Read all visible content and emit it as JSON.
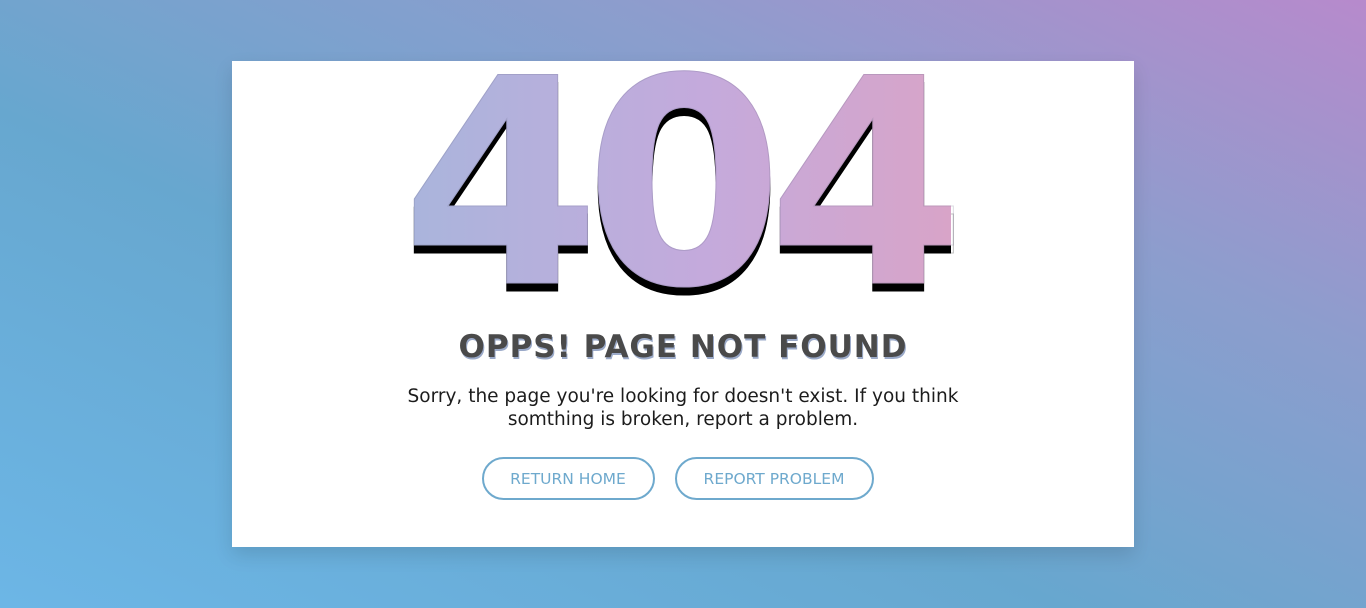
{
  "error": {
    "code": "404",
    "title": "OPPS! PAGE NOT FOUND",
    "message": "Sorry, the page you're looking for doesn't exist. If you think somthing is broken, report a problem."
  },
  "actions": {
    "home_label": "RETURN HOME",
    "report_label": "REPORT PROBLEM"
  },
  "colors": {
    "background_start": "#6cb6e6",
    "background_end": "#b78acc",
    "accent": "#6ea9cd",
    "title_text": "#4a4a4a"
  }
}
